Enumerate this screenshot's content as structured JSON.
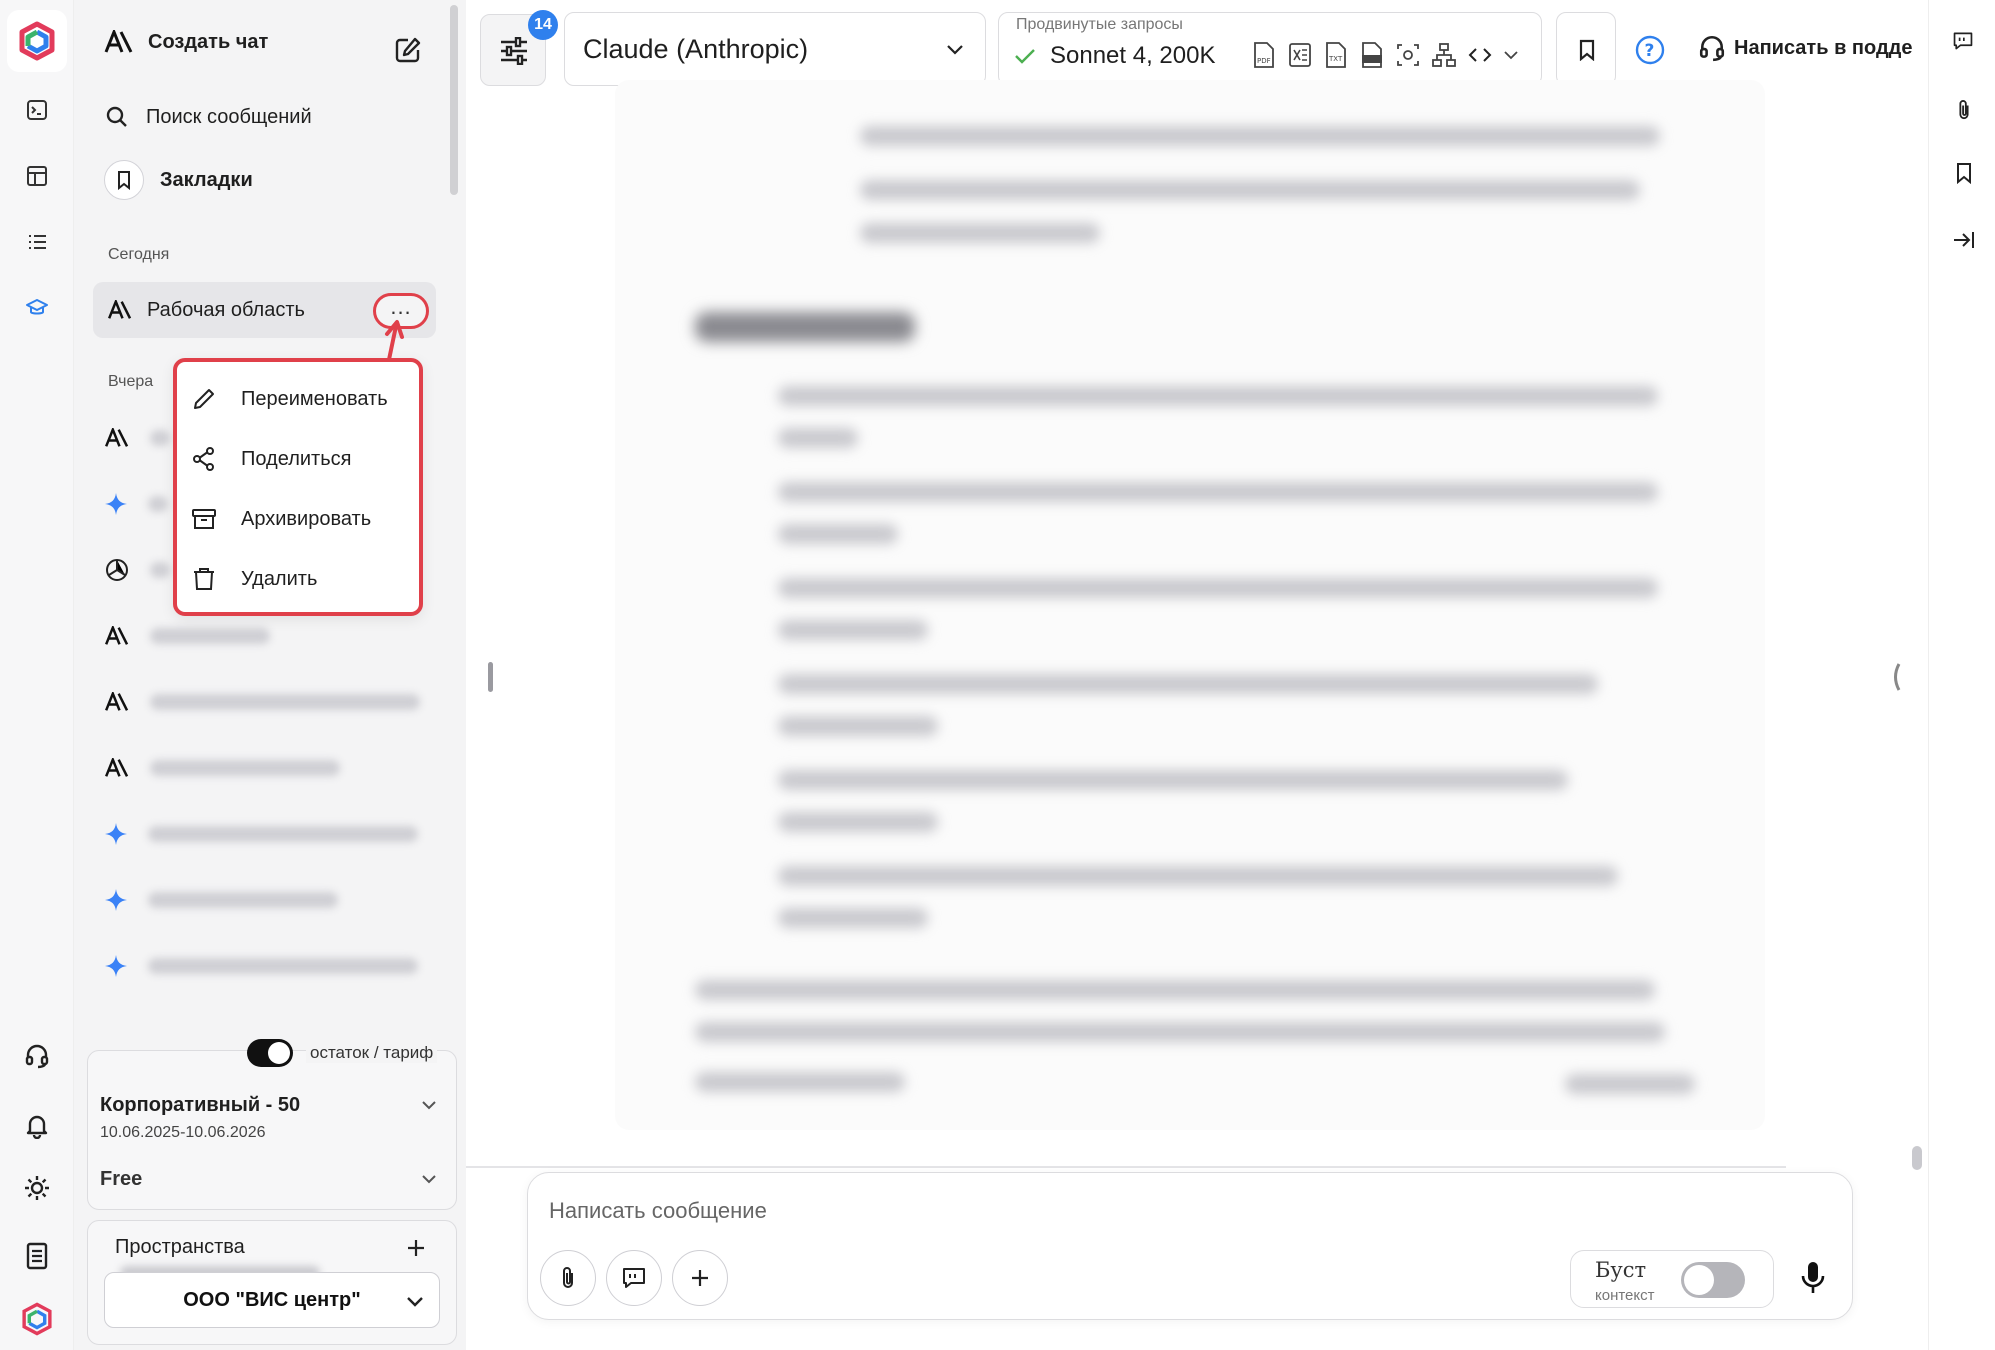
{
  "sidebar": {
    "new_chat": "Создать чат",
    "search": "Поиск сообщений",
    "bookmarks": "Закладки",
    "today_label": "Сегодня",
    "yesterday_label": "Вчера",
    "workspace": "Рабочая область"
  },
  "context_menu": {
    "rename": "Переименовать",
    "share": "Поделиться",
    "archive": "Архивировать",
    "delete": "Удалить"
  },
  "tariff": {
    "toggle_label": "остаток / тариф",
    "plan_name": "Корпоративный - 50",
    "plan_dates": "10.06.2025-10.06.2026",
    "free_label": "Free"
  },
  "spaces": {
    "title": "Пространства",
    "org": "ООО \"ВИС центр\""
  },
  "topbar": {
    "settings_badge": "14",
    "model": "Claude (Anthropic)",
    "advanced_label": "Продвинутые запросы",
    "sub_model": "Sonnet 4, 200K",
    "support": "Написать в подде"
  },
  "composer": {
    "placeholder": "Написать сообщение",
    "boost_title": "Буст",
    "boost_sub": "контекст"
  },
  "colors": {
    "highlight": "#e0404a",
    "badge": "#2f80ed",
    "check": "#4caf50",
    "gemini_blue": "#3b82f6"
  }
}
